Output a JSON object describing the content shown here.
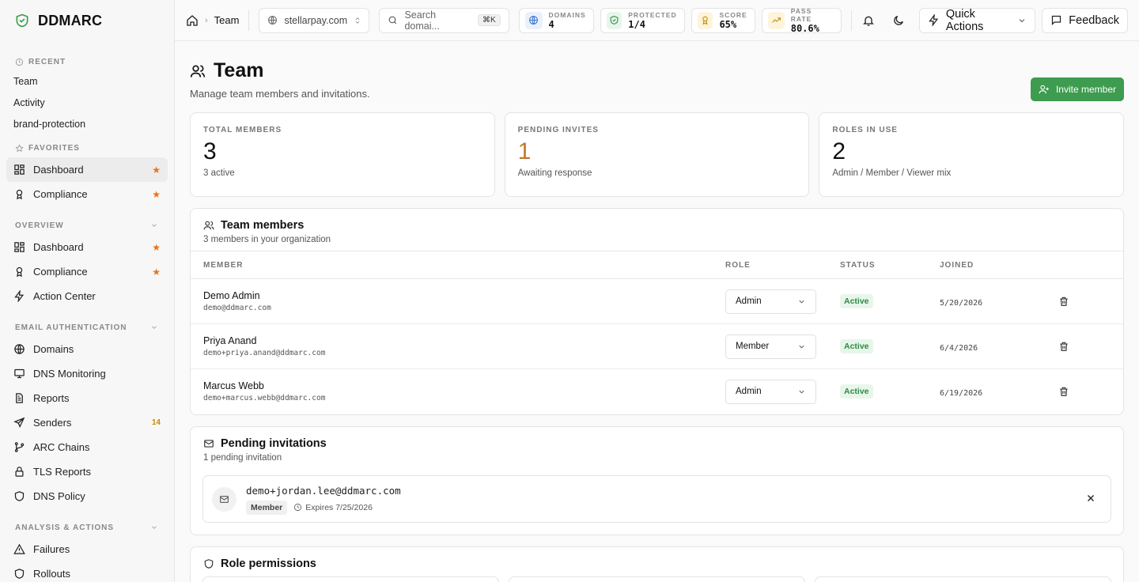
{
  "brand": {
    "name": "DDMARC",
    "accent": "#3d9c4f"
  },
  "sidebar": {
    "recent_label": "RECENT",
    "recent": [
      "Team",
      "Activity",
      "brand-protection"
    ],
    "favorites_label": "FAVORITES",
    "favorites": [
      {
        "label": "Dashboard",
        "icon": "dashboard-icon"
      },
      {
        "label": "Compliance",
        "icon": "compliance-icon"
      }
    ],
    "overview_label": "OVERVIEW",
    "overview": [
      {
        "label": "Dashboard",
        "icon": "dashboard-icon"
      },
      {
        "label": "Compliance",
        "icon": "compliance-icon"
      },
      {
        "label": "Action Center",
        "icon": "bolt-icon"
      }
    ],
    "email_auth_label": "EMAIL AUTHENTICATION",
    "email_auth": [
      {
        "label": "Domains",
        "icon": "globe-icon"
      },
      {
        "label": "DNS Monitoring",
        "icon": "monitor-icon"
      },
      {
        "label": "Reports",
        "icon": "file-icon"
      },
      {
        "label": "Senders",
        "icon": "send-icon",
        "badge": "14"
      },
      {
        "label": "ARC Chains",
        "icon": "branch-icon"
      },
      {
        "label": "TLS Reports",
        "icon": "lock-icon"
      },
      {
        "label": "DNS Policy",
        "icon": "shield-icon"
      }
    ],
    "analysis_label": "ANALYSIS & ACTIONS",
    "analysis": [
      {
        "label": "Failures",
        "icon": "warning-icon"
      },
      {
        "label": "Rollouts",
        "icon": "rollout-icon"
      }
    ]
  },
  "topbar": {
    "breadcrumb": "Team",
    "domain": "stellarpay.com",
    "search_placeholder": "Search domai...",
    "search_shortcut": "⌘K",
    "stats": [
      {
        "key": "DOMAINS",
        "value": "4",
        "icon": "globe-icon",
        "bg": "#eaf1fb",
        "fg": "#3b74c9"
      },
      {
        "key": "PROTECTED",
        "value": "1/4",
        "icon": "shield-check-icon",
        "bg": "#e7f6ea",
        "fg": "#2f8a45"
      },
      {
        "key": "SCORE",
        "value": "65%",
        "icon": "award-icon",
        "bg": "#fdf4dc",
        "fg": "#c98a00"
      },
      {
        "key": "PASS RATE",
        "value": "80.6%",
        "icon": "trend-icon",
        "bg": "#fdf4dc",
        "fg": "#c98a00"
      }
    ],
    "quick_actions": "Quick Actions",
    "feedback": "Feedback"
  },
  "page": {
    "title": "Team",
    "subtitle": "Manage team members and invitations.",
    "invite_button": "Invite member"
  },
  "summary": [
    {
      "key": "TOTAL MEMBERS",
      "value": "3",
      "sub": "3 active",
      "color": "#111111"
    },
    {
      "key": "PENDING INVITES",
      "value": "1",
      "sub": "Awaiting response",
      "color": "#c07a2c"
    },
    {
      "key": "ROLES IN USE",
      "value": "2",
      "sub": "Admin / Member / Viewer mix",
      "color": "#111111"
    }
  ],
  "members": {
    "title": "Team members",
    "description": "3 members in your organization",
    "columns": [
      "MEMBER",
      "ROLE",
      "STATUS",
      "JOINED"
    ],
    "rows": [
      {
        "name": "Demo Admin",
        "email": "demo@ddmarc.com",
        "role": "Admin",
        "status": "Active",
        "joined": "5/20/2026"
      },
      {
        "name": "Priya Anand",
        "email": "demo+priya.anand@ddmarc.com",
        "role": "Member",
        "status": "Active",
        "joined": "6/4/2026"
      },
      {
        "name": "Marcus Webb",
        "email": "demo+marcus.webb@ddmarc.com",
        "role": "Admin",
        "status": "Active",
        "joined": "6/19/2026"
      }
    ]
  },
  "invitations": {
    "title": "Pending invitations",
    "description": "1 pending invitation",
    "items": [
      {
        "email": "demo+jordan.lee@ddmarc.com",
        "role": "Member",
        "expires": "Expires 7/25/2026"
      }
    ]
  },
  "permissions": {
    "title": "Role permissions"
  }
}
